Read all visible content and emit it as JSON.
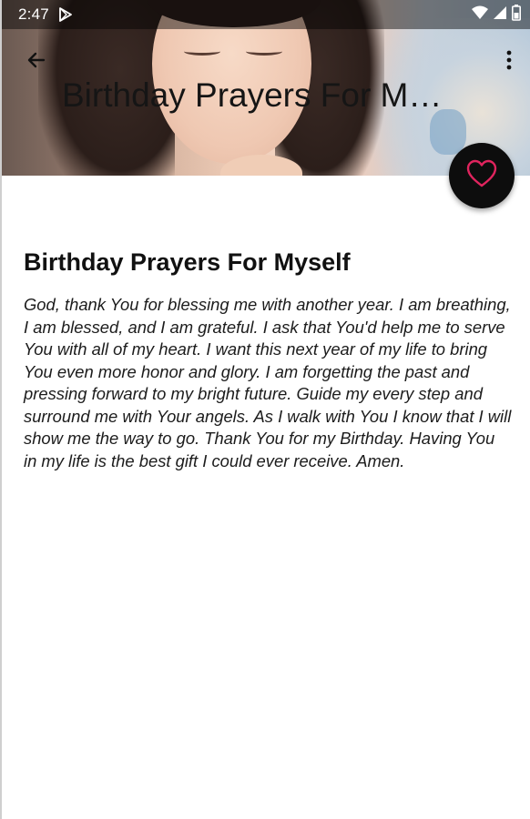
{
  "status_bar": {
    "time": "2:47",
    "icons": [
      "play-store-icon",
      "wifi-icon",
      "signal-icon",
      "battery-icon"
    ]
  },
  "toolbar": {
    "title": "Birthday Prayers For Myself",
    "back_icon": "arrow-left-icon",
    "more_icon": "more-vert-icon"
  },
  "favorite": {
    "icon": "heart-outline-icon",
    "icon_color": "#e0245e",
    "fab_color": "#0d0d0d"
  },
  "article": {
    "heading": "Birthday Prayers For Myself",
    "body": "God, thank You for blessing me with another year. I am breathing, I am blessed, and I am grateful. I ask that You'd help me to serve You with all of my heart. I want this next year of my life to bring You even more honor and glory. I am forgetting the past and pressing forward to my bright future. Guide my every step and surround me with Your angels. As I walk with You I know that I will show me the way to go. Thank You for my Birthday. Having You in my life is the best gift I could ever receive. Amen."
  }
}
